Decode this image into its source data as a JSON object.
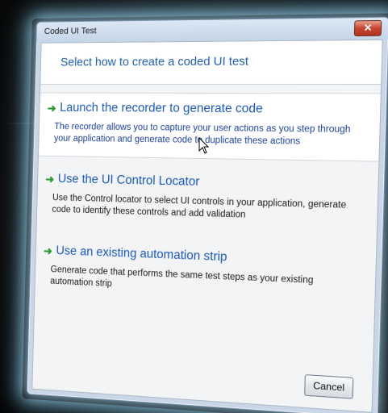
{
  "window": {
    "title": "Coded UI Test",
    "close_label": "✕"
  },
  "header": {
    "text": "Select how to create a coded UI test"
  },
  "options": [
    {
      "title": "Launch the recorder to generate code",
      "description": "The recorder allows you to capture your user actions as you step through your application and generate code to duplicate these actions",
      "icon": "green-arrow-icon",
      "selected": true
    },
    {
      "title": "Use the UI Control Locator",
      "description": "Use the Control locator to select UI controls in your application, generate code to identify these controls and add validation",
      "icon": "green-arrow-icon",
      "selected": false
    },
    {
      "title": "Use an existing automation strip",
      "description": "Generate code that performs the same test steps as your existing automation strip",
      "icon": "green-arrow-icon",
      "selected": false
    }
  ],
  "footer": {
    "cancel_label": "Cancel"
  },
  "colors": {
    "accent_text": "#1a58c0",
    "arrow_green": "#2e9a3a",
    "close_red": "#c8452e",
    "glow": "#78bedc"
  }
}
